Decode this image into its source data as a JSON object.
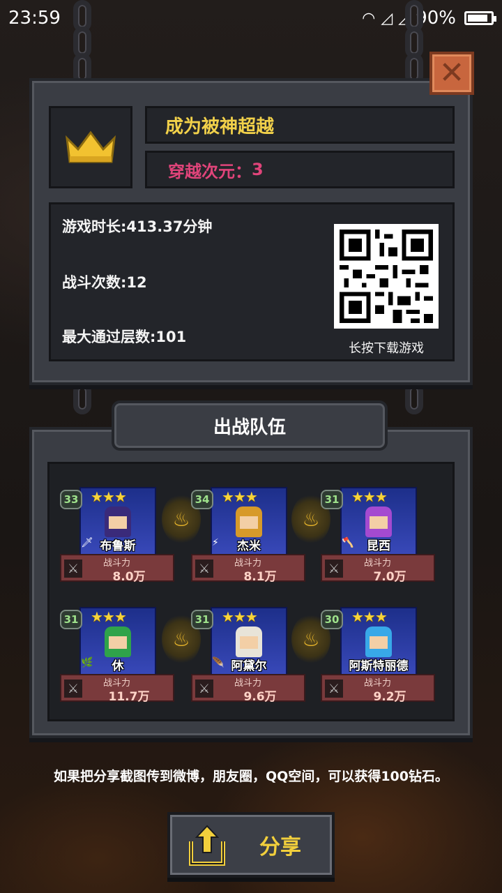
{
  "status_bar": {
    "time": "23:59",
    "battery": "90%"
  },
  "summary": {
    "title": "成为被神超越",
    "dimension_label": "穿越次元：",
    "dimension_value": "3"
  },
  "stats": {
    "play_time": "游戏时长:413.37分钟",
    "battles": "战斗次数:12",
    "max_floor": "最大通过层数:101",
    "qr_caption": "长按下载游戏"
  },
  "team": {
    "header": "出战队伍",
    "power_label": "战斗力",
    "heroes": [
      {
        "level": "33",
        "stars": "★★★",
        "name": "布鲁斯",
        "power": "8.0万",
        "color": "#3a2a7a"
      },
      {
        "level": "34",
        "stars": "★★★",
        "name": "杰米",
        "power": "8.1万",
        "color": "#d79a2a"
      },
      {
        "level": "31",
        "stars": "★★★",
        "name": "昆西",
        "power": "7.0万",
        "color": "#a44ad0"
      },
      {
        "level": "31",
        "stars": "★★★",
        "name": "休",
        "power": "11.7万",
        "color": "#2fa34a"
      },
      {
        "level": "31",
        "stars": "★★★",
        "name": "阿黛尔",
        "power": "9.6万",
        "color": "#e8e4d8"
      },
      {
        "level": "30",
        "stars": "★★★",
        "name": "阿斯特丽德",
        "power": "9.2万",
        "color": "#38a8e8"
      }
    ]
  },
  "share": {
    "note": "如果把分享截图传到微博，朋友圈，QQ空间，可以获得100钻石。",
    "button_label": "分享"
  },
  "colors": {
    "accent_gold": "#f2d14a",
    "accent_pink": "#e0447a",
    "close": "#c8663e"
  }
}
